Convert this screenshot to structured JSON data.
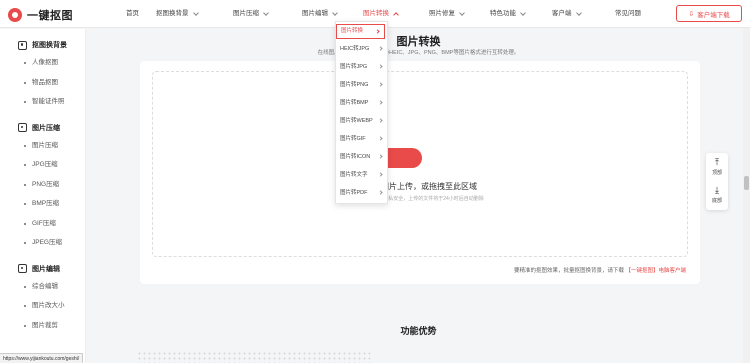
{
  "header": {
    "logo_text": "一键抠图",
    "nav": [
      {
        "label": "首页",
        "caret": false
      },
      {
        "label": "抠图换背景",
        "caret": true
      },
      {
        "label": "图片压缩",
        "caret": true
      },
      {
        "label": "图片编辑",
        "caret": true
      },
      {
        "label": "图片转换",
        "caret": true,
        "active": true
      },
      {
        "label": "照片修复",
        "caret": true
      },
      {
        "label": "特色功能",
        "caret": true
      },
      {
        "label": "客户端",
        "caret": true
      },
      {
        "label": "常见问题",
        "caret": false
      }
    ],
    "download_label": "客户端下载"
  },
  "sidebar": {
    "groups": [
      {
        "title": "抠图换背景",
        "items": [
          "人像抠图",
          "物品抠图",
          "智能证件照"
        ]
      },
      {
        "title": "图片压缩",
        "items": [
          "图片压缩",
          "JPG压缩",
          "PNG压缩",
          "BMP压缩",
          "GIF压缩",
          "JPEG压缩"
        ]
      },
      {
        "title": "图片编辑",
        "items": [
          "综合编辑",
          "图片改大小",
          "图片裁剪"
        ]
      }
    ]
  },
  "main": {
    "title": "图片转换",
    "subtitle": "在线图片格式互转功能，支持HEIC、JPG、PNG、BMP等图片格式进行互转处理。",
    "upload_text": "选择图片上传，或拖拽至此区域",
    "upload_hint": "为保障您的隐私安全，上传的文件将于24小时后自动删除",
    "footer_text": "要精准的抠图效果，批量抠图换背景，请下载",
    "footer_link": "【一键抠图】电脑客户端",
    "section_title": "功能优势"
  },
  "dropdown": {
    "items": [
      "图片转换",
      "HEIC转JPG",
      "图片转JPG",
      "图片转PNG",
      "图片转BMP",
      "图片转WEBP",
      "图片转GIF",
      "图片转ICON",
      "图片转文字",
      "图片转PDF"
    ],
    "selected_index": 0
  },
  "float": {
    "top_label": "顶部",
    "bottom_label": "底部"
  },
  "status_url": "https://www.yijiankoutu.com/geshi/",
  "colors": {
    "accent": "#e94a4a"
  }
}
